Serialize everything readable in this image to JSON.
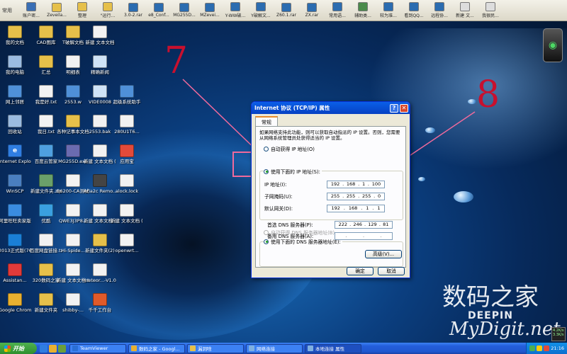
{
  "quick_launch": {
    "label": "常用",
    "items": [
      {
        "label": "账户密...",
        "color": "#3a6fb5"
      },
      {
        "label": "Zeveila...",
        "color": "#e6c04a"
      },
      {
        "label": "整理",
        "color": "#e6c04a"
      },
      {
        "label": "\"运行...",
        "color": "#e6c04a"
      },
      {
        "label": "3.0-2.rar",
        "color": "#2b6cb0"
      },
      {
        "label": "e8_Conf...",
        "color": "#2b6cb0"
      },
      {
        "label": "MG255D...",
        "color": "#2b6cb0"
      },
      {
        "label": "MZevei...",
        "color": "#2b6cb0"
      },
      {
        "label": "Y-WW破...",
        "color": "#2b6cb0"
      },
      {
        "label": "Y破解文...",
        "color": "#2b6cb0"
      },
      {
        "label": "Z60.1.rar",
        "color": "#2b6cb0"
      },
      {
        "label": "ZX.rar",
        "color": "#2b6cb0"
      },
      {
        "label": "常用语...",
        "color": "#2b6cb0"
      },
      {
        "label": "辅助类...",
        "color": "#4a8a4a"
      },
      {
        "label": "较为准...",
        "color": "#2b6cb0"
      },
      {
        "label": "看到QQ...",
        "color": "#2b6cb0"
      },
      {
        "label": "远程协...",
        "color": "#2b6cb0"
      },
      {
        "label": "新建 文...",
        "color": "#dddddd"
      },
      {
        "label": "我很民...",
        "color": "#dddddd"
      }
    ]
  },
  "desktop_icons": [
    {
      "label": "我的文档",
      "col": 0,
      "row": 0,
      "color": "#e6c04a",
      "glyph": ""
    },
    {
      "label": "CAD图库",
      "col": 1,
      "row": 0,
      "color": "#e6c04a",
      "glyph": ""
    },
    {
      "label": "T破解文档",
      "col": 2,
      "row": 0,
      "color": "#e6c04a",
      "glyph": ""
    },
    {
      "label": "新建 文本文档",
      "col": 3,
      "row": 0,
      "color": "#f2f2f2",
      "glyph": ""
    },
    {
      "label": "我的电脑",
      "col": 0,
      "row": 1,
      "color": "#9bbbe0",
      "glyph": ""
    },
    {
      "label": "汇总",
      "col": 1,
      "row": 1,
      "color": "#e6c04a",
      "glyph": ""
    },
    {
      "label": "明细表",
      "col": 2,
      "row": 1,
      "color": "#f2f2f2",
      "glyph": ""
    },
    {
      "label": "精确新闻",
      "col": 3,
      "row": 1,
      "color": "#cfe3f7",
      "glyph": ""
    },
    {
      "label": "网上邻居",
      "col": 0,
      "row": 2,
      "color": "#4f90d8",
      "glyph": ""
    },
    {
      "label": "我是好.txt",
      "col": 1,
      "row": 2,
      "color": "#f2f2f2",
      "glyph": ""
    },
    {
      "label": "2553.w",
      "col": 2,
      "row": 2,
      "color": "#4f90d8",
      "glyph": ""
    },
    {
      "label": "VIDE0008",
      "col": 3,
      "row": 2,
      "color": "#cfe3f7",
      "glyph": ""
    },
    {
      "label": "超级系统助手",
      "col": 4,
      "row": 2,
      "color": "#4f90d8",
      "glyph": ""
    },
    {
      "label": "回收站",
      "col": 0,
      "row": 3,
      "color": "#9bbbe0",
      "glyph": ""
    },
    {
      "label": "我日.txt",
      "col": 1,
      "row": 3,
      "color": "#f2f2f2",
      "glyph": ""
    },
    {
      "label": "各种记事本文档",
      "col": 2,
      "row": 3,
      "color": "#e6c04a",
      "glyph": ""
    },
    {
      "label": "2553.bak",
      "col": 3,
      "row": 3,
      "color": "#f2f2f2",
      "glyph": ""
    },
    {
      "label": "280U1T6...",
      "col": 4,
      "row": 3,
      "color": "#f2f2f2",
      "glyph": ""
    },
    {
      "label": "Internet Explorer",
      "col": 0,
      "row": 4,
      "color": "#2f7de1",
      "glyph": "e"
    },
    {
      "label": "百度云管家",
      "col": 1,
      "row": 4,
      "color": "#4fa0e0",
      "glyph": ""
    },
    {
      "label": "MG255D.exe",
      "col": 2,
      "row": 4,
      "color": "#6b6bb0",
      "glyph": ""
    },
    {
      "label": "新建 文本文档 (2).txt",
      "col": 3,
      "row": 4,
      "color": "#f2f2f2",
      "glyph": ""
    },
    {
      "label": "应用宝",
      "col": 4,
      "row": 4,
      "color": "#e24a3a",
      "glyph": ""
    },
    {
      "label": "WinSCP",
      "col": 0,
      "row": 5,
      "color": "#4a7fc0",
      "glyph": ""
    },
    {
      "label": "新建文件夹.zip",
      "col": 1,
      "row": 5,
      "color": "#6aa06a",
      "glyph": ""
    },
    {
      "label": "B6200-CA测试文档.bin",
      "col": 2,
      "row": 5,
      "color": "#f2f2f2",
      "glyph": ""
    },
    {
      "label": "Aria2c Remo...",
      "col": 3,
      "row": 5,
      "color": "#444444",
      "glyph": ""
    },
    {
      "label": "alock.lock",
      "col": 4,
      "row": 5,
      "color": "#f2f2f2",
      "glyph": ""
    },
    {
      "label": "阿里旺旺卖家版",
      "col": 0,
      "row": 6,
      "color": "#3a8ce0",
      "glyph": ""
    },
    {
      "label": "优酷",
      "col": 1,
      "row": 6,
      "color": "#3aa0e0",
      "glyph": ""
    },
    {
      "label": "QWE3J3P8...",
      "col": 2,
      "row": 6,
      "color": "#f2f2f2",
      "glyph": ""
    },
    {
      "label": "新建 文本文档 (3).txt",
      "col": 3,
      "row": 6,
      "color": "#f2f2f2",
      "glyph": ""
    },
    {
      "label": "新建 文本文档 (5).txt",
      "col": 4,
      "row": 6,
      "color": "#f2f2f2",
      "glyph": ""
    },
    {
      "label": "2013正式版(7661)",
      "col": 0,
      "row": 7,
      "color": "#1a7fd6",
      "glyph": ""
    },
    {
      "label": "百度网盘链接.txt",
      "col": 1,
      "row": 7,
      "color": "#f2f2f2",
      "glyph": ""
    },
    {
      "label": "Hi-Spide...",
      "col": 2,
      "row": 7,
      "color": "#f2f2f2",
      "glyph": ""
    },
    {
      "label": "新建文件夹(2)",
      "col": 3,
      "row": 7,
      "color": "#e6c04a",
      "glyph": ""
    },
    {
      "label": "openwrt...",
      "col": 4,
      "row": 7,
      "color": "#f2f2f2",
      "glyph": ""
    },
    {
      "label": "Assistan...",
      "col": 0,
      "row": 8,
      "color": "#e03a3a",
      "glyph": ""
    },
    {
      "label": "320数码之家",
      "col": 1,
      "row": 8,
      "color": "#e6c04a",
      "glyph": ""
    },
    {
      "label": "新建 文本文档.txt",
      "col": 2,
      "row": 8,
      "color": "#f2f2f2",
      "glyph": ""
    },
    {
      "label": "meteor...-V1.0.3...",
      "col": 3,
      "row": 8,
      "color": "#f2f2f2",
      "glyph": ""
    },
    {
      "label": "Google Chrome",
      "col": 0,
      "row": 9,
      "color": "#e8b030",
      "glyph": ""
    },
    {
      "label": "新建文件夹",
      "col": 1,
      "row": 9,
      "color": "#e6c04a",
      "glyph": ""
    },
    {
      "label": "shibby-...",
      "col": 2,
      "row": 9,
      "color": "#f2f2f2",
      "glyph": ""
    },
    {
      "label": "千千工作台",
      "col": 3,
      "row": 9,
      "color": "#e05a2a",
      "glyph": ""
    }
  ],
  "annotations": {
    "label_7": "7",
    "label_8": "8",
    "color": "#c8102e"
  },
  "dialog": {
    "title": "Internet 协议 (TCP/IP) 属性",
    "help_label": "?",
    "close_label": "✕",
    "tab": "常规",
    "description": "如果网络支持此功能，则可以获取自动指派的 IP 设置。否则，您需要从网络系统管理员处获得适当的 IP 设置。",
    "auto_ip_label": "自动获得 IP 地址(O)",
    "manual_ip_label": "使用下面的 IP 地址(S):",
    "ip_label": "IP 地址(I):",
    "ip_value": [
      "192",
      "168",
      "1",
      "100"
    ],
    "subnet_label": "子网掩码(U):",
    "subnet_value": [
      "255",
      "255",
      "255",
      "0"
    ],
    "gateway_label": "默认网关(D):",
    "gateway_value": [
      "192",
      "168",
      "1",
      "1"
    ],
    "auto_dns_label": "自动获得 DNS 服务器地址(B)",
    "manual_dns_label": "使用下面的 DNS 服务器地址(E):",
    "preferred_dns_label": "首选 DNS 服务器(P):",
    "preferred_dns_value": [
      "222",
      "246",
      "129",
      "81"
    ],
    "alternate_dns_label": "备用 DNS 服务器(A):",
    "alternate_dns_value": [
      ".",
      ".",
      "."
    ],
    "advanced_label": "高级(V)...",
    "ok_label": "确定",
    "cancel_label": "取消"
  },
  "watermark": {
    "cn": "数码之家",
    "en": "MyDigit.net",
    "brand": "DEEPIN"
  },
  "net_meter": {
    "up": "4.2K/s",
    "down": "3.3K/s"
  },
  "taskbar": {
    "start_label": "开始",
    "tasks": [
      {
        "label": "TeamViewer",
        "color": "#2a6fd6",
        "active": false
      },
      {
        "label": "数码之家 - Googl...",
        "color": "#e8b030",
        "active": false
      },
      {
        "label": "漏洞啥",
        "color": "#e6c04a",
        "active": false
      },
      {
        "label": "网络连接",
        "color": "#7fb0e0",
        "active": false
      },
      {
        "label": "本地连接 属性",
        "color": "#7fb0e0",
        "active": true
      }
    ],
    "clock": "21:16"
  }
}
